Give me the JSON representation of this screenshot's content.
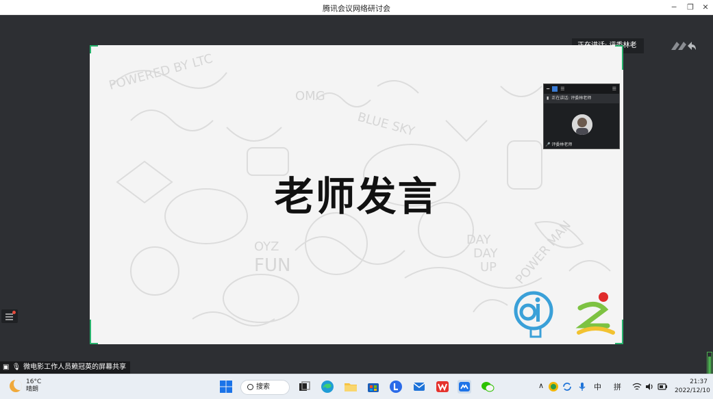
{
  "window": {
    "title": "腾讯会议网络研讨会",
    "minimize": "─",
    "maximize": "❐",
    "close": "✕"
  },
  "speaking": {
    "text": "正在讲话: 评委林老师;"
  },
  "slide": {
    "title": "老师发言"
  },
  "mini_window": {
    "speaking_text": "正在讲话: 评委林老师",
    "name": "评委林老师"
  },
  "share": {
    "label": "微电影工作人员赖冠英的屏幕共享"
  },
  "volume_level_percent": 90,
  "taskbar": {
    "weather_temp": "16°C",
    "weather_desc": "晴朗",
    "search_label": "搜索",
    "ime_lang": "中",
    "ime_mode": "拼",
    "time": "21:37",
    "date": "2022/12/10"
  }
}
